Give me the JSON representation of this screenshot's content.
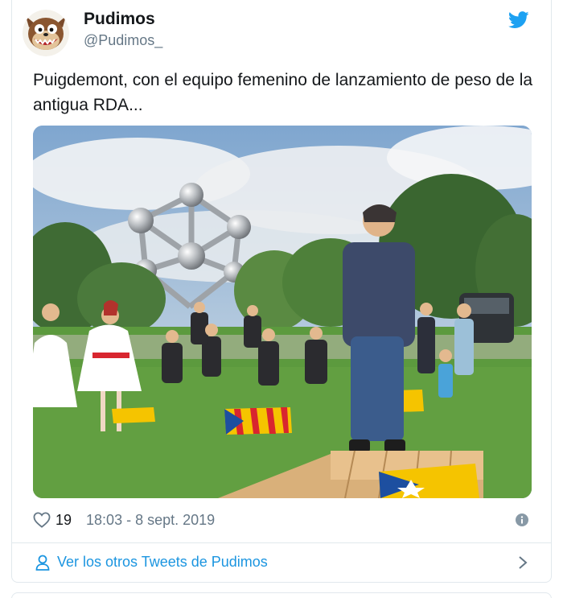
{
  "tweet": {
    "author_name": "Pudimos",
    "author_handle": "@Pudimos_",
    "text": "Puigdemont, con el equipo femenino de lanzamiento de peso de la antigua RDA...",
    "likes": "19",
    "timestamp": "18:03 - 8 sept. 2019"
  },
  "footer": {
    "more_tweets_label": "Ver los otros Tweets de Pudimos"
  },
  "icons": {
    "brand": "twitter-bird-icon",
    "like": "heart-icon",
    "info": "info-icon",
    "profile": "person-icon",
    "next": "chevron-right-icon"
  },
  "colors": {
    "link": "#1b95e0",
    "text": "#14171a",
    "secondary": "#657786",
    "border": "#e1e8ed"
  }
}
